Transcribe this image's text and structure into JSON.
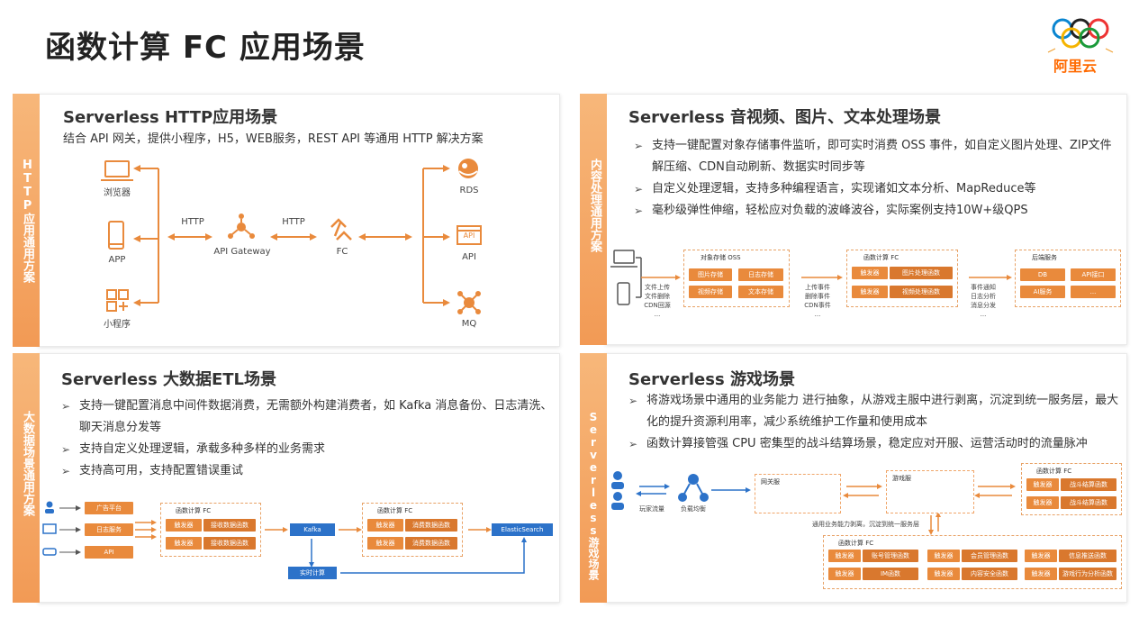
{
  "page": {
    "title": "函数计算 FC 应用场景"
  },
  "logo": {
    "text": "阿里云"
  },
  "http": {
    "tab": "HTTP应用通用方案",
    "title": "Serverless HTTP应用场景",
    "subtitle": "结合 API 网关，提供小程序，H5，WEB服务，REST API 等通用 HTTP 解决方案",
    "clients": [
      "浏览器",
      "APP",
      "小程序"
    ],
    "http_left": "HTTP",
    "gateway": "API Gateway",
    "http_right": "HTTP",
    "fc": "FC",
    "backends": [
      "RDS",
      "API",
      "MQ"
    ],
    "api_icon_text": "API"
  },
  "media": {
    "tab": "内容处理通用方案",
    "title": "Serverless 音视频、图片、文本处理场景",
    "bullets": [
      "支持一键配置对象存储事件监听，即可实时消费 OSS 事件，如自定义图片处理、ZIP文件解压缩、CDN自动刷新、数据实时同步等",
      "自定义处理逻辑，支持多种编程语言，实现诸如文本分析、MapReduce等",
      "毫秒级弹性伸缩，轻松应对负载的波峰波谷，实际案例支持10W+级QPS"
    ],
    "upload_text": [
      "文件上传",
      "文件删除",
      "CDN回源",
      "..."
    ],
    "oss_title": "对象存储 OSS",
    "oss_items": [
      "图片存储",
      "日志存储",
      "视频存储",
      "文本存储"
    ],
    "events_text": [
      "上传事件",
      "删除事件",
      "CDN事件",
      "..."
    ],
    "fc_title": "函数计算 FC",
    "fc_rows": [
      [
        "触发器",
        "图片处理函数"
      ],
      [
        "触发器",
        "视频处理函数"
      ]
    ],
    "notify_text": [
      "事件通知",
      "日志分析",
      "消息分发",
      "..."
    ],
    "backend_title": "后端服务",
    "backend_items": [
      "DB",
      "API接口",
      "AI服务",
      "..."
    ]
  },
  "etl": {
    "tab": "大数据场景通用方案",
    "title": "Serverless 大数据ETL场景",
    "bullets": [
      "支持一键配置消息中间件数据消费，无需额外构建消费者，如 Kafka 消息备份、日志清洗、聊天消息分发等",
      "支持自定义处理逻辑，承载多种多样的业务需求",
      "支持高可用，支持配置错误重试"
    ],
    "sources": [
      "广告平台",
      "日志服务",
      "API"
    ],
    "fc1_title": "函数计算 FC",
    "fc1_rows": [
      [
        "触发器",
        "接收数据函数"
      ],
      [
        "触发器",
        "接收数据函数"
      ]
    ],
    "kafka": "Kafka",
    "realtime": "实时计算",
    "fc2_title": "函数计算 FC",
    "fc2_rows": [
      [
        "触发器",
        "消费数据函数"
      ],
      [
        "触发器",
        "消费数据函数"
      ]
    ],
    "es": "ElasticSearch"
  },
  "game": {
    "tab": "Serverless游戏场景",
    "title": "Serverless 游戏场景",
    "bullets": [
      "将游戏场景中通用的业务能力 进行抽象，从游戏主服中进行剥离，沉淀到统一服务层，最大化的提升资源利用率，减少系统维护工作量和使用成本",
      "函数计算接管强 CPU 密集型的战斗结算场景，稳定应对开服、运营活动时的流量脉冲"
    ],
    "players": "玩家流量",
    "lb": "负载均衡",
    "gateway_title": "网关服",
    "game_title": "游戏服",
    "common_note": "通用业务能力剥离，沉淀到统一服务层",
    "fc_right_title": "函数计算 FC",
    "fc_right_rows": [
      [
        "触发器",
        "战斗结算函数"
      ],
      [
        "触发器",
        "战斗结算函数"
      ]
    ],
    "fc_bottom_title": "函数计算 FC",
    "fc_bottom_rows": [
      [
        "触发器",
        "账号管理函数",
        "触发器",
        "会员管理函数",
        "触发器",
        "信息推送函数"
      ],
      [
        "触发器",
        "IM函数",
        "触发器",
        "内容安全函数",
        "触发器",
        "游戏行为分析函数"
      ]
    ]
  },
  "colors": {
    "accent": "#ff6a00",
    "orange": "#e98a3c",
    "blue": "#2c72c9",
    "tab": "#f29a55"
  }
}
